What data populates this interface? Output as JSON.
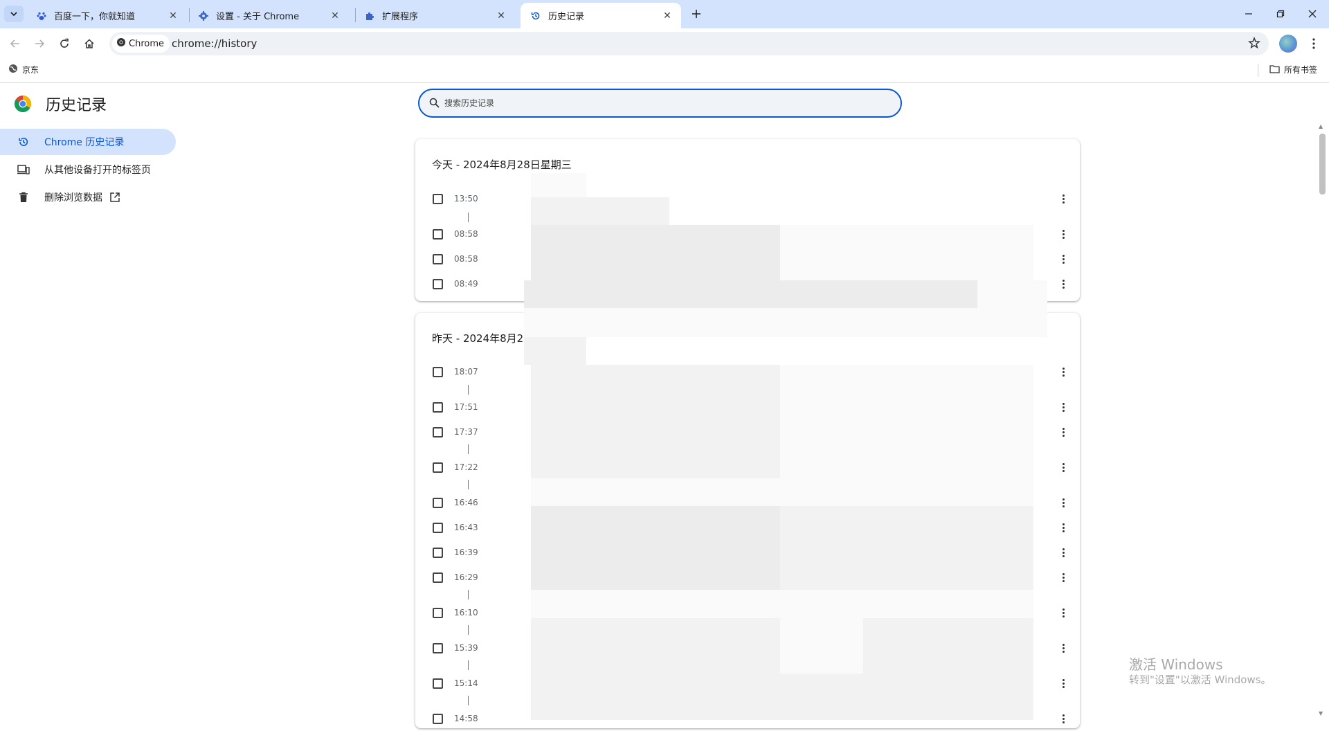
{
  "tabs": [
    {
      "title": "百度一下，你就知道",
      "icon": "baidu-paw-icon"
    },
    {
      "title": "设置 - 关于 Chrome",
      "icon": "gear-icon"
    },
    {
      "title": "扩展程序",
      "icon": "puzzle-icon"
    },
    {
      "title": "历史记录",
      "icon": "history-icon",
      "active": true
    }
  ],
  "omnibox": {
    "chip_label": "Chrome",
    "url": "chrome://history"
  },
  "bookmarks": {
    "items": [
      {
        "label": "京东"
      }
    ],
    "all_bookmarks_label": "所有书签"
  },
  "sidebar": {
    "title": "历史记录",
    "items": [
      {
        "label": "Chrome 历史记录",
        "icon": "history-icon",
        "selected": true
      },
      {
        "label": "从其他设备打开的标签页",
        "icon": "devices-icon"
      },
      {
        "label": "删除浏览数据",
        "icon": "trash-icon"
      }
    ]
  },
  "search": {
    "placeholder": "搜索历史记录"
  },
  "groups": [
    {
      "title": "今天 - 2024年8月28日星期三",
      "times": [
        "13:50",
        "08:58",
        "08:58",
        "08:49"
      ]
    },
    {
      "title": "昨天 - 2024年8月2",
      "times": [
        "18:07",
        "17:51",
        "17:37",
        "17:22",
        "16:46",
        "16:43",
        "16:39",
        "16:29",
        "16:10",
        "15:39",
        "15:14",
        "14:58"
      ]
    }
  ],
  "watermark": {
    "line1": "激活 Windows",
    "line2": "转到\"设置\"以激活 Windows。"
  },
  "colors": {
    "tabstrip": "#d3e3fd",
    "accent": "#0b57d0",
    "selected_bg": "#d3e3fd"
  }
}
